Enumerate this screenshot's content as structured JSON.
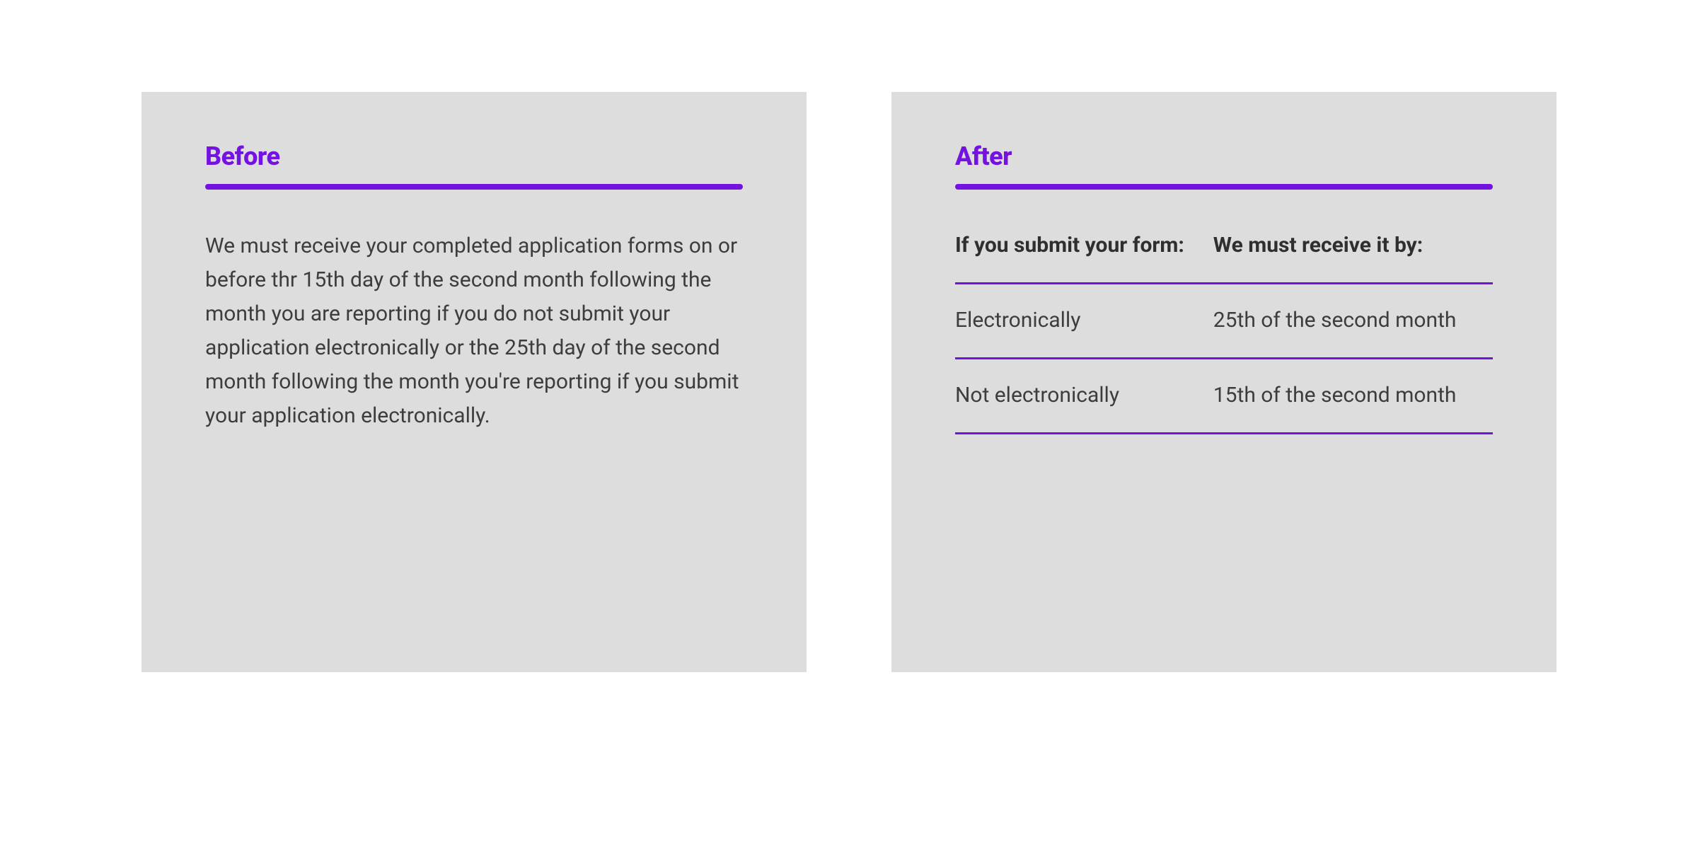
{
  "before": {
    "heading": "Before",
    "text": "We must receive your completed application forms on or before thr 15th day of the second month following the month you are reporting if you do not submit your application electronically or the 25th day of the second month following the month you're reporting if you submit your application electronically."
  },
  "after": {
    "heading": "After",
    "table": {
      "header_left": "If you submit your form:",
      "header_right": "We must receive it by:",
      "rows": [
        {
          "left": "Electronically",
          "right": "25th of the second month"
        },
        {
          "left": "Not electronically",
          "right": "15th of the second month"
        }
      ]
    }
  },
  "colors": {
    "accent": "#7412e0",
    "panel_bg": "#dddddd",
    "text": "#3d3d3d"
  }
}
